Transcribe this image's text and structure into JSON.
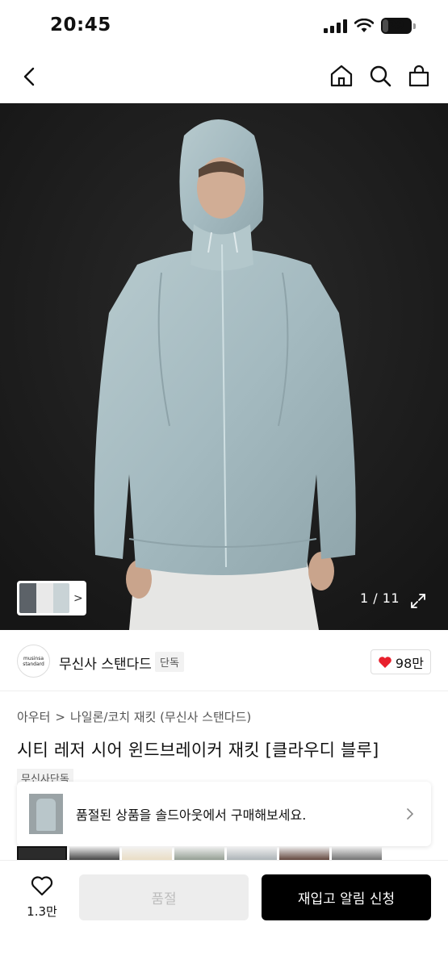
{
  "status_bar": {
    "time": "20:45",
    "battery": "29",
    "battery_level": 0.29
  },
  "nav": {
    "icons": [
      "back-icon",
      "home-icon",
      "search-icon",
      "shopping-bag-icon"
    ]
  },
  "gallery": {
    "current": "1",
    "total": "11",
    "counter": "1 / 11",
    "preview_arrow": ">"
  },
  "brand": {
    "logo_line1": "musinsa",
    "logo_line2": "standard",
    "name": "무신사 스탠다드",
    "badge": "단독",
    "likes": "98만"
  },
  "product": {
    "breadcrumb": [
      "아우터",
      "나일론/코치 재킷 (무신사 스탠다드)"
    ],
    "breadcrumb_sep": ">",
    "title": "시티 레저 시어 윈드브레이커 재킷 [클라우디 블루]",
    "exclusive_tag": "무신사단독"
  },
  "soldout_banner": {
    "text": "품절된 상품을 솔드아웃에서 구매해보세요."
  },
  "bottom_bar": {
    "wish_count": "1.3만",
    "soldout_label": "품절",
    "restock_label": "재입고 알림 신청"
  },
  "colors": {
    "accent": "#000000",
    "heart": "#e8202d",
    "jacket": "#a9bfc5",
    "background_photo": "#1e1e1e"
  }
}
